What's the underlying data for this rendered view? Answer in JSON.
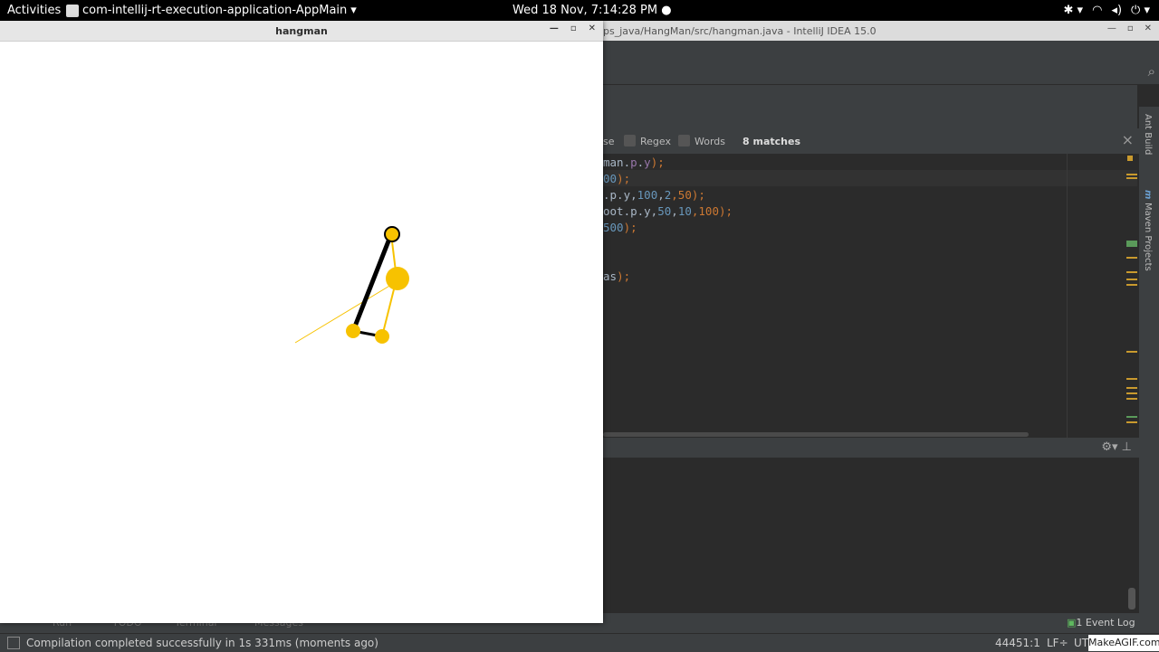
{
  "topbar": {
    "activities": "Activities",
    "app_name": "com-intellij-rt-execution-application-AppMain",
    "dropdown": "▾",
    "clock": "Wed 18 Nov,  7:14:28 PM",
    "icons": [
      "accessibility-icon",
      "wifi-icon",
      "volume-icon",
      "power-icon"
    ]
  },
  "ide": {
    "title": "ps_java/HangMan/src/hangman.java - IntelliJ IDEA 15.0",
    "find": {
      "case_label": "se",
      "regex_label": "Regex",
      "words_label": "Words",
      "matches": "8 matches"
    },
    "code_lines": [
      {
        "a": "man.",
        "b": "p",
        "c": ".",
        "d": "y",
        "e": ");"
      },
      {
        "a": "",
        "b": "",
        "c": "",
        "d": "00",
        "e": ");"
      },
      {
        "a": ".p.y,",
        "b": "100",
        "c": ",",
        "d": "2",
        "e": ",50);"
      },
      {
        "a": "oot.p.y,",
        "b": "50",
        "c": ",",
        "d": "10",
        "e": ",100);"
      },
      {
        "a": "",
        "b": "",
        "c": "",
        "d": "500",
        "e": ");"
      },
      {
        "a": "as",
        "b": "",
        "c": "",
        "d": "",
        "e": ");"
      }
    ],
    "sidebar": {
      "ant_build": "Ant Build",
      "maven_projects": "Maven Projects"
    },
    "bottom_tabs": [
      "Run",
      "TODO",
      "Terminal",
      "Messages"
    ],
    "event_log": "Event Log",
    "event_log_count": "1",
    "status": {
      "message": "Compilation completed successfully in 1s 331ms (moments ago)",
      "position": "44451:1",
      "line_sep": "LF÷",
      "encoding": "UT"
    }
  },
  "hangman_window": {
    "title": "hangman",
    "controls": [
      "minimize",
      "maximize",
      "close"
    ],
    "accent_color": "#f7c200"
  },
  "watermark": "MakeAGIF.com"
}
